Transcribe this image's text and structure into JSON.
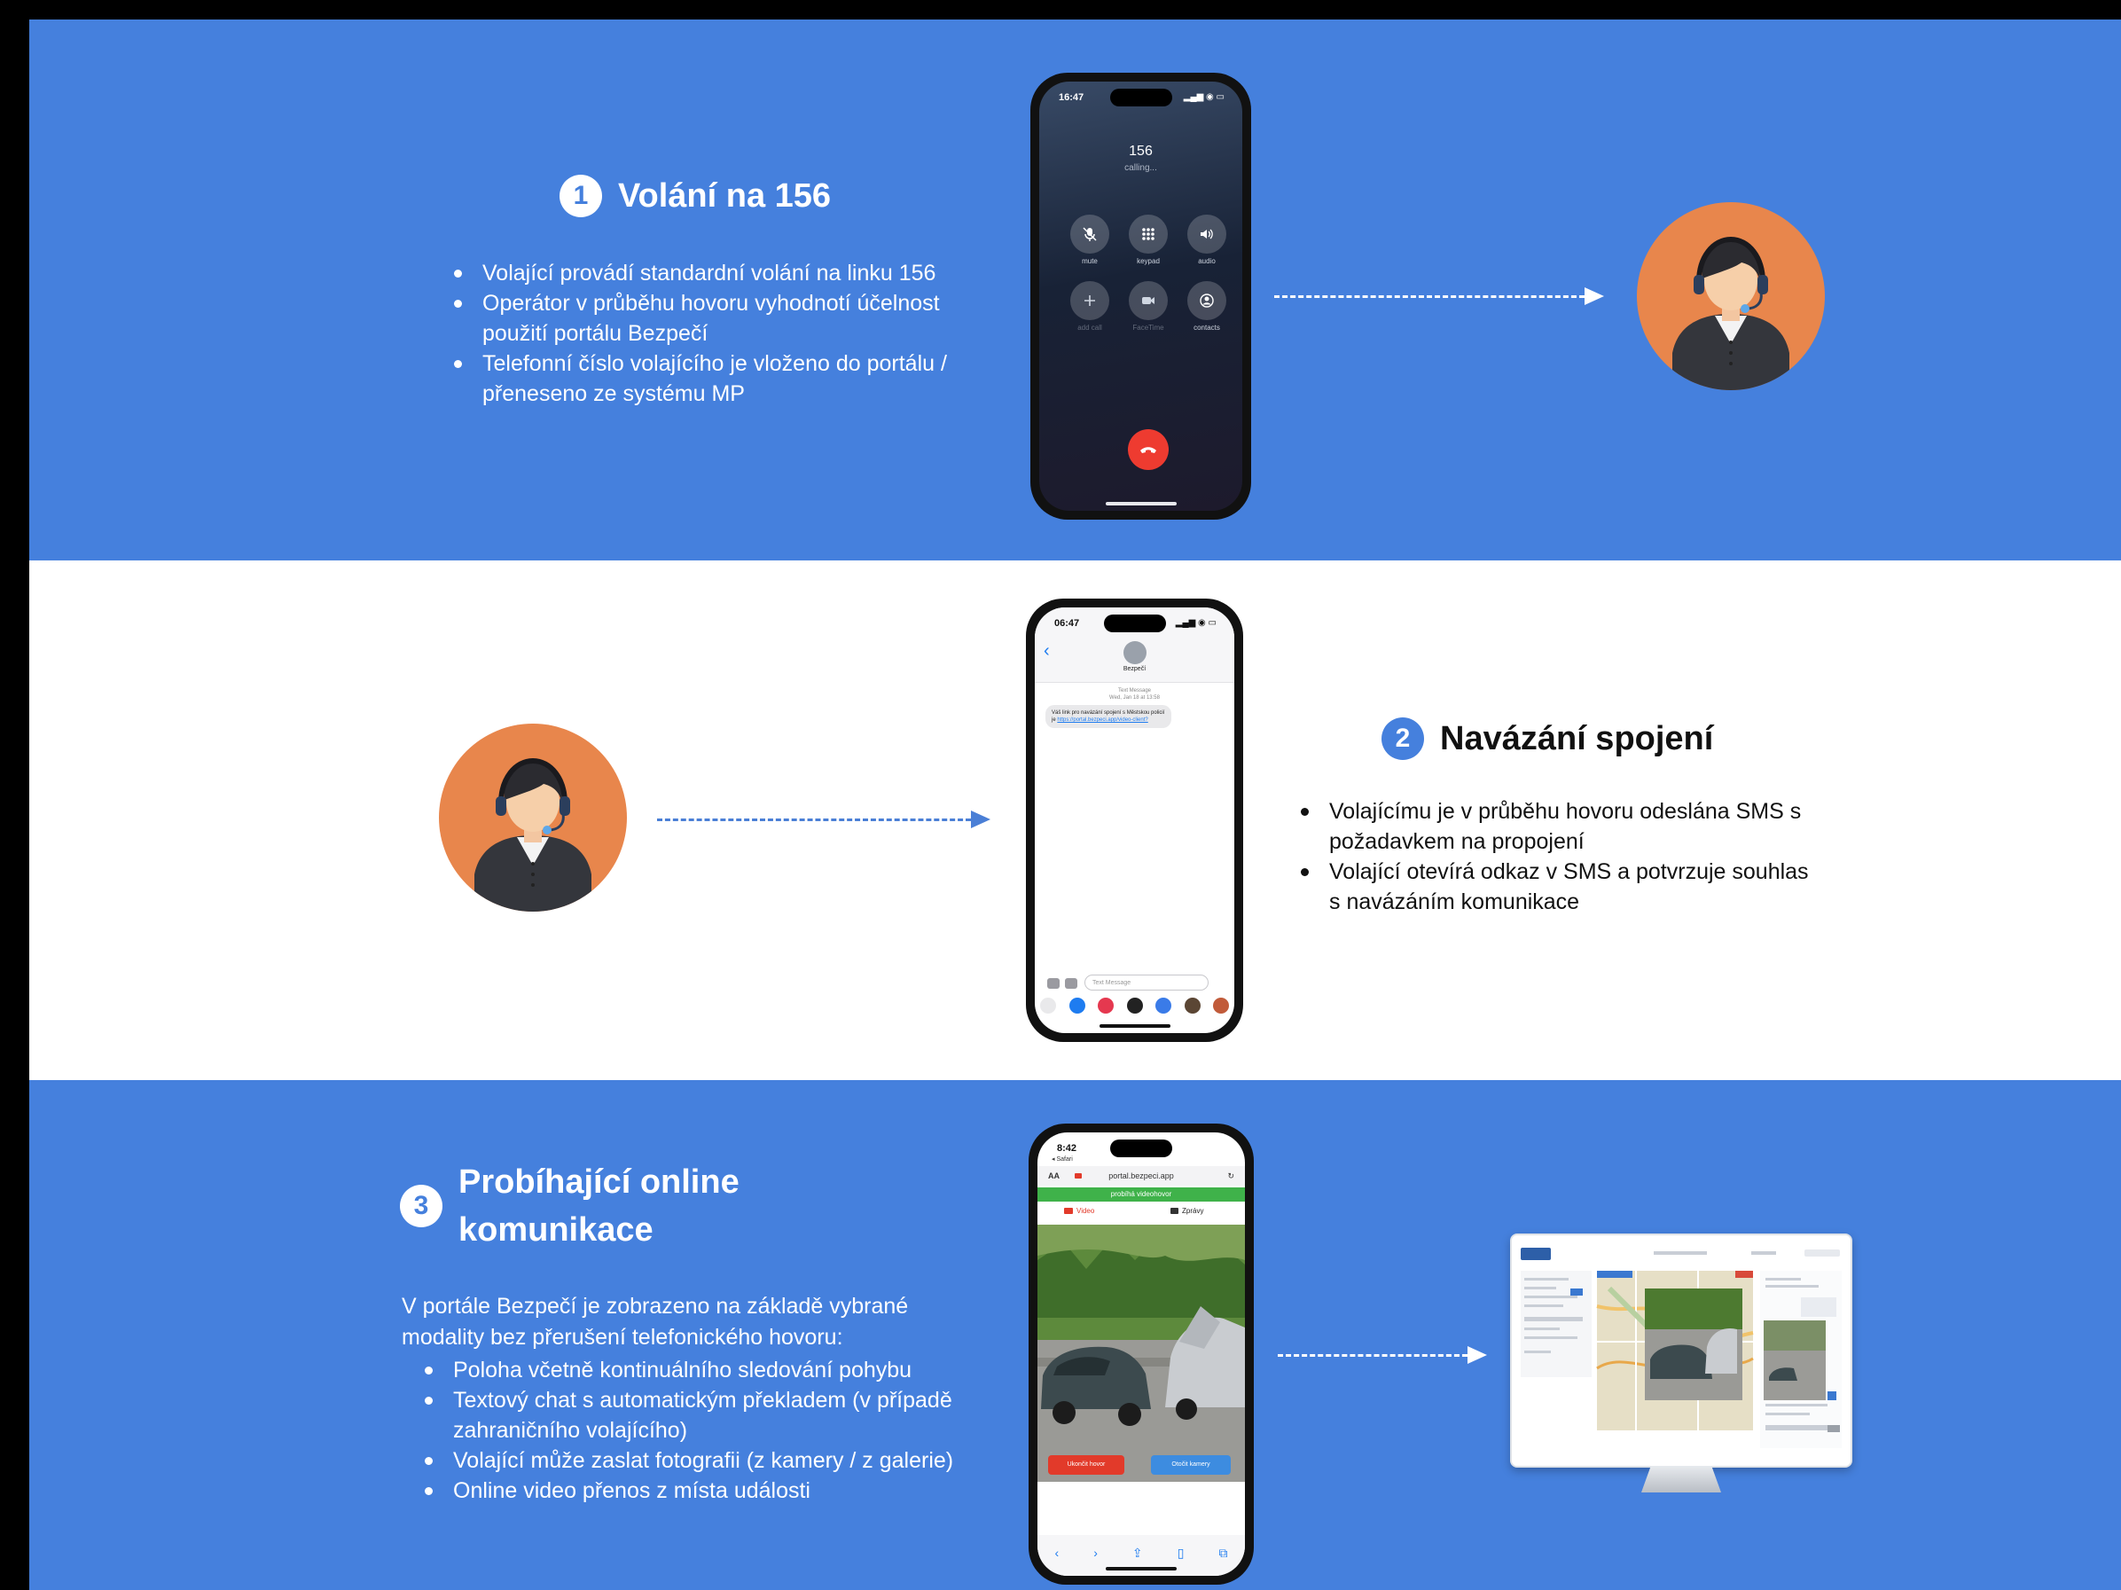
{
  "steps": [
    {
      "number": "1",
      "title": "Volání na 156",
      "bullets": [
        "Volající provádí standardní volání na linku 156",
        "Operátor v průběhu hovoru vyhodnotí účelnost použití portálu Bezpečí",
        "Telefonní číslo volajícího je vloženo do portálu / přeneseno ze systému MP"
      ]
    },
    {
      "number": "2",
      "title": "Navázání spojení",
      "bullets": [
        "Volajícímu je v průběhu hovoru odeslána SMS s požadavkem na propojení",
        "Volající otevírá odkaz v SMS a potvrzuje souhlas s navázáním komunikace"
      ]
    },
    {
      "number": "3",
      "title_line1": "Probíhající online",
      "title_line2": "komunikace",
      "intro": "V portále Bezpečí je zobrazeno na základě vybrané modality bez přerušení telefonického hovoru:",
      "bullets": [
        "Poloha včetně kontinuálního sledování pohybu",
        "Textový chat s automatickým překladem (v případě zahraničního volajícího)",
        "Volající může zaslat fotografii (z kamery / z galerie)",
        "Online video přenos z místa události"
      ]
    }
  ],
  "phone_call": {
    "time": "16:47",
    "status_icons": "▂▄▆ ◉ ▭",
    "number": "156",
    "status": "calling...",
    "buttons": [
      "mute",
      "keypad",
      "audio",
      "add call",
      "FaceTime",
      "contacts"
    ]
  },
  "phone_sms": {
    "time": "06:47",
    "status_icons": "▂▄▆ ◉ ▭",
    "contact": "Bezpečí",
    "meta_line1": "Text Message",
    "meta_line2": "Wed, Jan 18 at 13:58",
    "message": "Váš link pro navázání spojení s Městskou policií je",
    "link": "https://portal.bezpeci.app/video-client?",
    "input_placeholder": "Text Message"
  },
  "phone_portal": {
    "time": "8:42",
    "back_label": "◂ Safari",
    "url_prefix": "AA",
    "url": "portal.bezpeci.app",
    "banner": "probíhá videohovor",
    "tab_video": "Video",
    "tab_messages": "Zprávy",
    "btn_end": "Ukončit hovor",
    "btn_camera": "Otočit kamery"
  },
  "colors": {
    "band_blue": "#4580dd",
    "avatar_orange": "#e8864c",
    "end_call_red": "#ee3b30",
    "banner_green": "#3fb24a"
  }
}
